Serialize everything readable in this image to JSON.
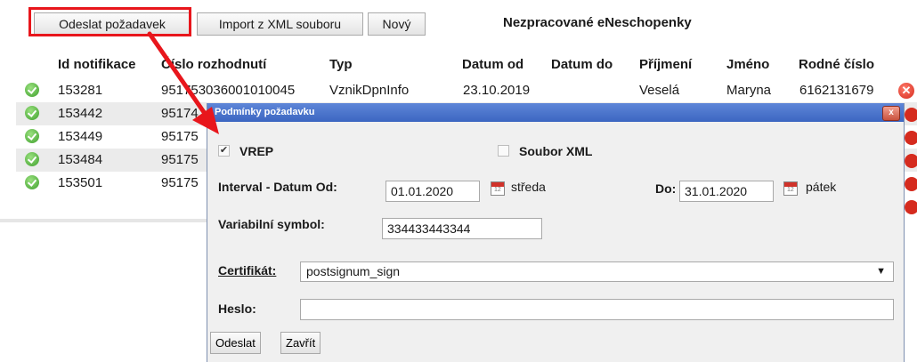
{
  "toolbar": {
    "send_label": "Odeslat požadavek",
    "import_label": "Import z XML souboru",
    "new_label": "Nový"
  },
  "page_title": "Nezpracované eNeschopenky",
  "grid": {
    "columns": [
      "Id notifikace",
      "Číslo rozhodnutí",
      "Typ",
      "Datum od",
      "Datum do",
      "Příjmení",
      "Jméno",
      "Rodné číslo"
    ],
    "rows": [
      {
        "id": "153281",
        "cislo": "951753036001010045",
        "typ": "VznikDpnInfo",
        "datum_od": "23.10.2019",
        "datum_do": "",
        "prijmeni": "Veselá",
        "jmeno": "Maryna",
        "rodne_cislo": "6162131679"
      },
      {
        "id": "153442",
        "cislo": "95174"
      },
      {
        "id": "153449",
        "cislo": "95175"
      },
      {
        "id": "153484",
        "cislo": "95175"
      },
      {
        "id": "153501",
        "cislo": "95175"
      }
    ]
  },
  "dialog": {
    "title": "Podmínky požadavku",
    "close_glyph": "x",
    "vrep_label": "VREP",
    "vrep_checked": true,
    "soubor_xml_label": "Soubor XML",
    "soubor_xml_checked": false,
    "interval_label": "Interval - Datum Od:",
    "date_from": "01.01.2020",
    "date_from_day": "středa",
    "do_label": "Do:",
    "date_to": "31.01.2020",
    "date_to_day": "pátek",
    "varsym_label": "Variabilní symbol:",
    "varsym_value": "334433443344",
    "cert_label": "Certifikát:",
    "cert_value": "postsignum_sign",
    "heslo_label": "Heslo:",
    "heslo_value": "",
    "send_label": "Odeslat",
    "close_label": "Zavřít"
  },
  "colors": {
    "highlight": "#e8161c",
    "dialog_title_bar": "#4a72cc",
    "row_alt": "#ebebeb"
  },
  "icons": {
    "ok": "green-check-circle-icon",
    "delete": "red-x-circle-icon",
    "calendar": "calendar-icon",
    "dropdown": "chevron-down-icon"
  }
}
